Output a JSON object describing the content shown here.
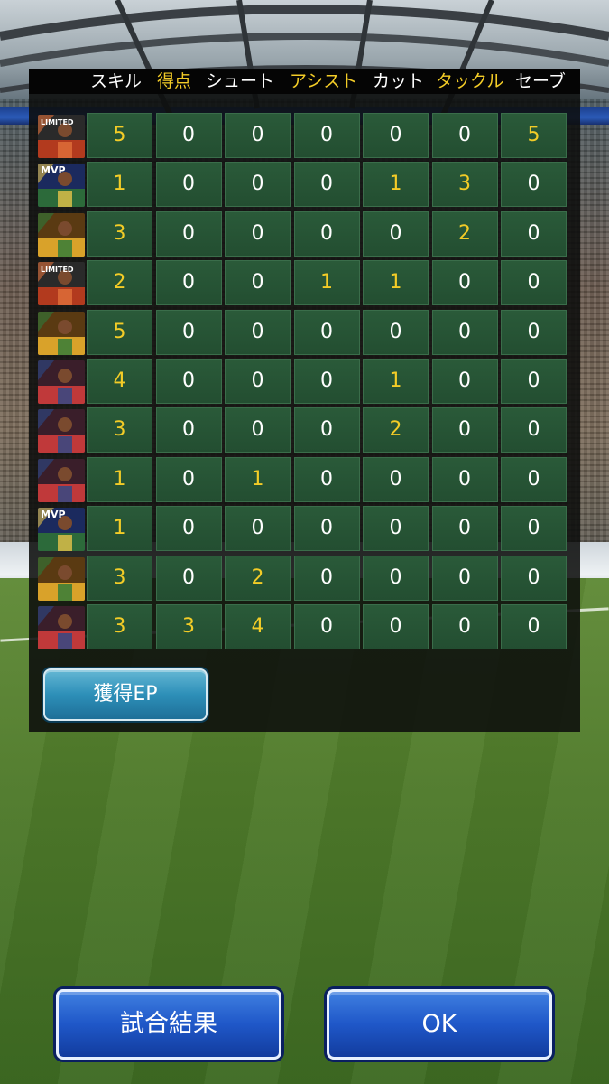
{
  "headers": [
    {
      "label": "スキル",
      "color": "white"
    },
    {
      "label": "得点",
      "color": "yellow"
    },
    {
      "label": "シュート",
      "color": "white"
    },
    {
      "label": "アシスト",
      "color": "yellow"
    },
    {
      "label": "カット",
      "color": "white"
    },
    {
      "label": "タックル",
      "color": "yellow"
    },
    {
      "label": "セーブ",
      "color": "white"
    }
  ],
  "rows": [
    {
      "card": "limited",
      "values": [
        "5",
        "0",
        "0",
        "0",
        "0",
        "0",
        "5"
      ]
    },
    {
      "card": "mvp",
      "values": [
        "1",
        "0",
        "0",
        "0",
        "1",
        "3",
        "0"
      ]
    },
    {
      "card": "special",
      "values": [
        "3",
        "0",
        "0",
        "0",
        "0",
        "2",
        "0"
      ]
    },
    {
      "card": "limited",
      "values": [
        "2",
        "0",
        "0",
        "1",
        "1",
        "0",
        "0"
      ]
    },
    {
      "card": "special",
      "values": [
        "5",
        "0",
        "0",
        "0",
        "0",
        "0",
        "0"
      ]
    },
    {
      "card": "standard",
      "values": [
        "4",
        "0",
        "0",
        "0",
        "1",
        "0",
        "0"
      ]
    },
    {
      "card": "standard",
      "values": [
        "3",
        "0",
        "0",
        "0",
        "2",
        "0",
        "0"
      ]
    },
    {
      "card": "standard",
      "values": [
        "1",
        "0",
        "1",
        "0",
        "0",
        "0",
        "0"
      ]
    },
    {
      "card": "mvp",
      "values": [
        "1",
        "0",
        "0",
        "0",
        "0",
        "0",
        "0"
      ]
    },
    {
      "card": "special",
      "values": [
        "3",
        "0",
        "2",
        "0",
        "0",
        "0",
        "0"
      ]
    },
    {
      "card": "standard",
      "values": [
        "3",
        "3",
        "4",
        "0",
        "0",
        "0",
        "0"
      ]
    }
  ],
  "card_text": {
    "limited": "LIMITED",
    "mvp": "MVP"
  },
  "buttons": {
    "ep_label": "獲得EP",
    "match_result_label": "試合結果",
    "ok_label": "OK"
  },
  "colors": {
    "header_highlight": "#f3cc27",
    "value_nonzero": "#f3cc27",
    "value_zero": "#ffffff",
    "cell_bg": "#2a5a39",
    "button_blue": "#1f57c8",
    "button_cyan": "#2d8fb8"
  }
}
